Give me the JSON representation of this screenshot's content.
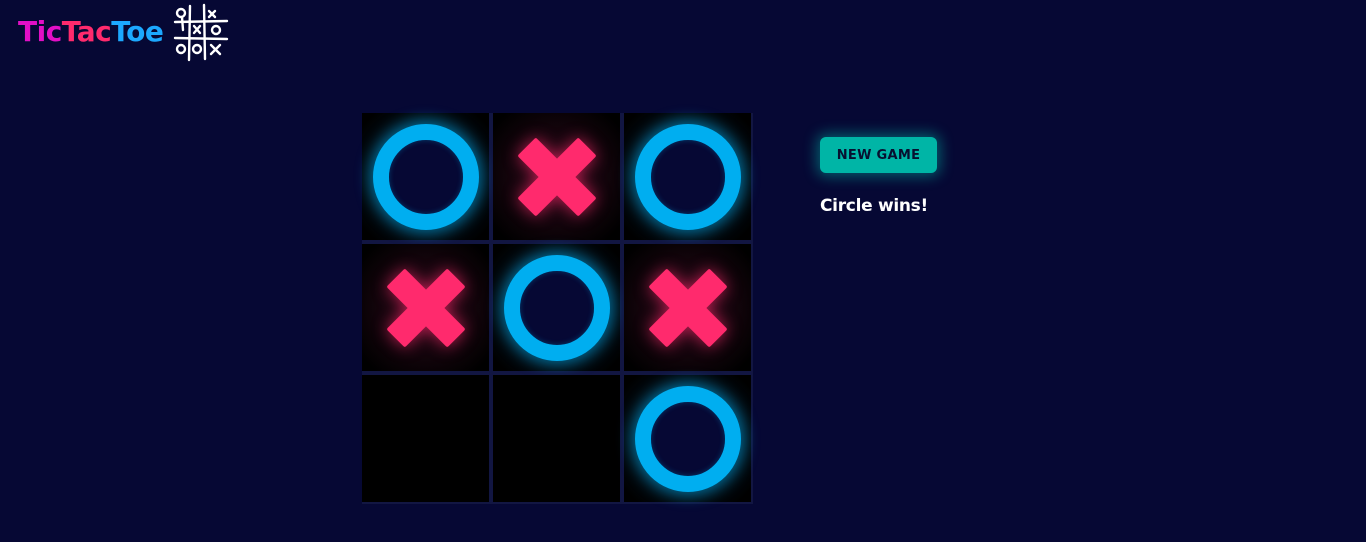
{
  "logo": {
    "part1": "Tic",
    "part2": "Tac",
    "part3": "Toe",
    "icon": "tictactoe-grid-icon"
  },
  "colors": {
    "background": "#060834",
    "logo_tic": "#e20fc6",
    "logo_tac": "#ff2a6d",
    "logo_toe": "#1ca8ff",
    "circle": "#00aef0",
    "cross": "#ff2a6d",
    "button": "#00b5a6",
    "button_text": "#071030",
    "status_text": "#ffffff"
  },
  "board": {
    "cells": [
      "O",
      "X",
      "O",
      "X",
      "O",
      "X",
      "",
      "",
      "O"
    ]
  },
  "controls": {
    "new_game_label": "NEW GAME"
  },
  "status": {
    "message": "Circle wins!"
  }
}
